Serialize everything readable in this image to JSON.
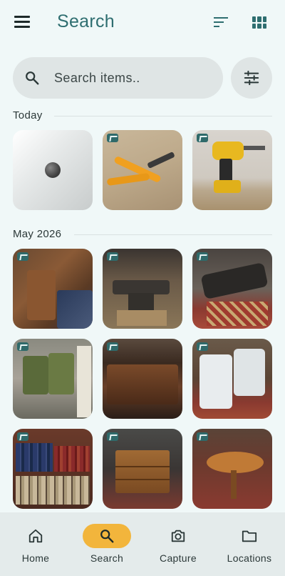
{
  "header": {
    "title": "Search",
    "menu_icon": "hamburger-menu-icon",
    "sort_icon": "sort-icon",
    "view_icon": "grid-view-icon"
  },
  "search": {
    "placeholder": "Search items..",
    "value": "",
    "filter_icon": "tune-icon"
  },
  "sections": [
    {
      "label": "Today",
      "items": [
        {
          "name": "item-placeholder",
          "has_badge": false
        },
        {
          "name": "item-pliers",
          "has_badge": true
        },
        {
          "name": "item-drill",
          "has_badge": true
        }
      ]
    },
    {
      "label": "May 2026",
      "items": [
        {
          "name": "item-wooden-chair",
          "has_badge": true
        },
        {
          "name": "item-anvil-1",
          "has_badge": true
        },
        {
          "name": "item-anvil-2",
          "has_badge": true
        },
        {
          "name": "item-jerry-cans",
          "has_badge": true
        },
        {
          "name": "item-chest",
          "has_badge": true
        },
        {
          "name": "item-garden-chairs",
          "has_badge": true
        },
        {
          "name": "item-bookshelf",
          "has_badge": true
        },
        {
          "name": "item-dresser",
          "has_badge": true
        },
        {
          "name": "item-round-table",
          "has_badge": true
        }
      ]
    }
  ],
  "colors": {
    "accent": "#2e6e70",
    "active_pill": "#f2b53c",
    "background": "#f0f8f8",
    "nav_background": "#e4ebeb"
  },
  "nav": {
    "active": "Search",
    "items": [
      {
        "label": "Home",
        "icon": "home-icon"
      },
      {
        "label": "Search",
        "icon": "search-icon"
      },
      {
        "label": "Capture",
        "icon": "camera-icon"
      },
      {
        "label": "Locations",
        "icon": "folder-icon"
      }
    ]
  }
}
